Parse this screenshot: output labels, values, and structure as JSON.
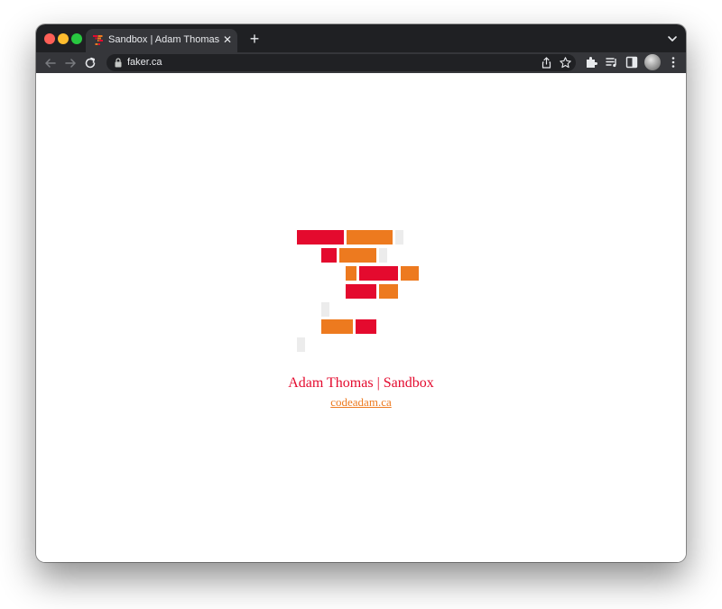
{
  "browser": {
    "tab": {
      "title": "Sandbox | Adam Thomas",
      "favicon": "brick-logo-icon",
      "close_icon": "close-icon"
    },
    "new_tab_icon": "plus-icon",
    "tab_search_icon": "chevron-down-icon",
    "toolbar": {
      "back_icon": "back-arrow-icon",
      "forward_icon": "forward-arrow-icon",
      "reload_icon": "reload-icon",
      "url": "faker.ca",
      "lock_icon": "lock-icon",
      "share_icon": "share-icon",
      "bookmark_icon": "star-icon",
      "extensions_icon": "puzzle-icon",
      "media_icon": "media-queue-icon",
      "sidepanel_icon": "side-panel-icon",
      "menu_icon": "kebab-menu-icon"
    }
  },
  "page": {
    "title": "Adam Thomas | Sandbox",
    "link_text": "codeadam.ca",
    "colors": {
      "red": "#e40a2e",
      "orange": "#ed7a1f",
      "gray": "#ececec"
    }
  }
}
